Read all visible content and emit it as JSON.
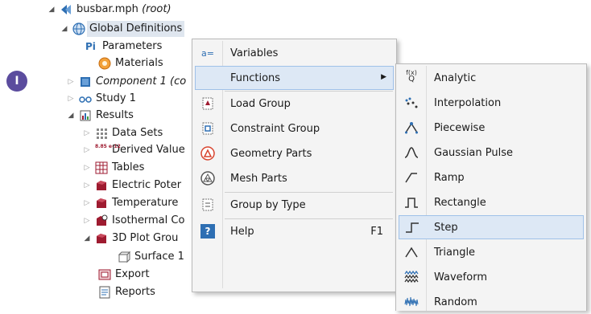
{
  "step_badge": "I",
  "tree": {
    "root": {
      "label": "busbar.mph",
      "suffix": "(root)"
    },
    "global_definitions": "Global Definitions",
    "parameters": "Parameters",
    "parameters_icon_text": "Pi",
    "materials": "Materials",
    "component": "Component 1 (co",
    "study": "Study 1",
    "results": "Results",
    "data_sets": "Data Sets",
    "derived_values": "Derived Value",
    "derived_icon_text": "8.85 e-12",
    "tables": "Tables",
    "electric_potential": "Electric Poter",
    "temperature": "Temperature",
    "isothermal": "Isothermal Co",
    "plot_group": "3D Plot Grou",
    "surface": "Surface 1",
    "export": "Export",
    "reports": "Reports"
  },
  "context_menu": {
    "variables": "Variables",
    "variables_icon_text": "a=",
    "functions": "Functions",
    "load_group": "Load Group",
    "constraint_group": "Constraint Group",
    "geometry_parts": "Geometry Parts",
    "mesh_parts": "Mesh Parts",
    "group_by_type": "Group by Type",
    "help": "Help",
    "help_shortcut": "F1",
    "help_icon_text": "?"
  },
  "functions_menu": {
    "items": [
      "Analytic",
      "Interpolation",
      "Piecewise",
      "Gaussian Pulse",
      "Ramp",
      "Rectangle",
      "Step",
      "Triangle",
      "Waveform",
      "Random"
    ],
    "analytic_icon_text": "f(x)",
    "highlighted": "Step"
  },
  "colors": {
    "badge": "#5b4c9e",
    "menu_highlight": "#dde8f5",
    "tree_selection": "#dfe6ef",
    "icon_blue": "#2e6fb3",
    "icon_red": "#9e1b30",
    "icon_orange": "#e07b1a"
  }
}
